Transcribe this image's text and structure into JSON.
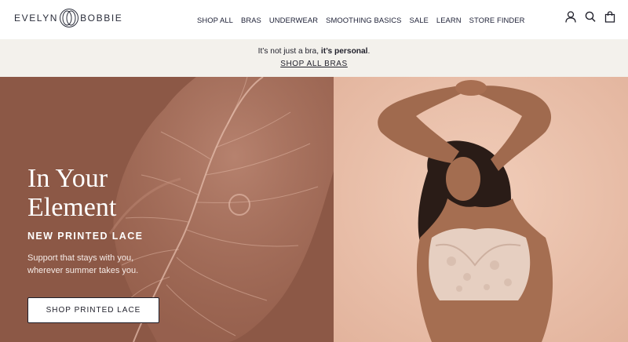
{
  "logo": {
    "left": "EVELYN",
    "right": "BOBBIE"
  },
  "nav": [
    {
      "label": "SHOP ALL"
    },
    {
      "label": "BRAS"
    },
    {
      "label": "UNDERWEAR"
    },
    {
      "label": "SMOOTHING BASICS"
    },
    {
      "label": "SALE"
    },
    {
      "label": "LEARN"
    },
    {
      "label": "STORE FINDER"
    }
  ],
  "header_icons": [
    "account-icon",
    "search-icon",
    "shopping-bag-icon"
  ],
  "promo": {
    "text_prefix": "It’s not just a bra, ",
    "text_bold": "it’s personal",
    "text_suffix": ".",
    "link": "SHOP ALL BRAS"
  },
  "hero": {
    "title_line1": "In Your",
    "title_line2": "Element",
    "subtitle": "NEW PRINTED LACE",
    "body_line1": "Support that stays with you,",
    "body_line2": "wherever summer takes you.",
    "cta": "SHOP PRINTED LACE"
  },
  "colors": {
    "hero_left_bg": "#8c5846",
    "hero_right_bg": "#e9c2ad",
    "promo_bg": "#f3f1ec",
    "text_dark": "#1f1f2a"
  }
}
